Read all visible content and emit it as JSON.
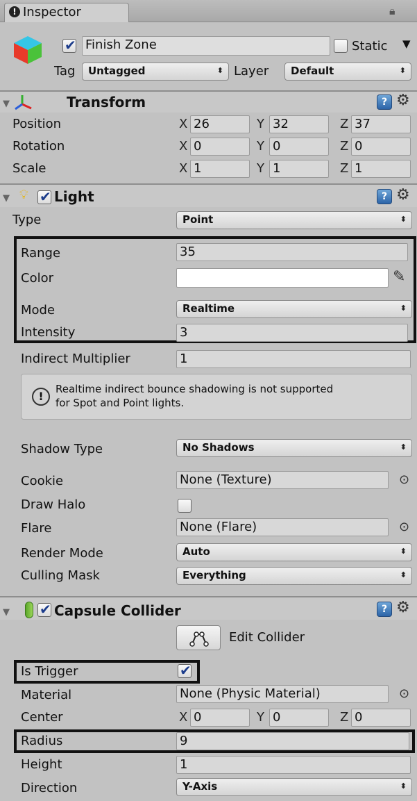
{
  "tab": {
    "title": "Inspector",
    "icon": "info-icon"
  },
  "object": {
    "enabled": true,
    "name": "Finish Zone",
    "static_label": "Static",
    "static_checked": false,
    "tag_label": "Tag",
    "tag_value": "Untagged",
    "layer_label": "Layer",
    "layer_value": "Default"
  },
  "transform": {
    "title": "Transform",
    "rows": [
      {
        "label": "Position",
        "x": "26",
        "y": "32",
        "z": "37"
      },
      {
        "label": "Rotation",
        "x": "0",
        "y": "0",
        "z": "0"
      },
      {
        "label": "Scale",
        "x": "1",
        "y": "1",
        "z": "1"
      }
    ]
  },
  "axes": {
    "x": "X",
    "y": "Y",
    "z": "Z"
  },
  "light": {
    "title": "Light",
    "enabled": true,
    "type_label": "Type",
    "type_value": "Point",
    "range_label": "Range",
    "range_value": "35",
    "color_label": "Color",
    "color_value": "#ffffff",
    "mode_label": "Mode",
    "mode_value": "Realtime",
    "intensity_label": "Intensity",
    "intensity_value": "3",
    "indirect_label": "Indirect Multiplier",
    "indirect_value": "1",
    "help_line1": "Realtime indirect bounce shadowing is not supported",
    "help_line2": "for Spot and Point lights.",
    "shadow_label": "Shadow Type",
    "shadow_value": "No Shadows",
    "cookie_label": "Cookie",
    "cookie_value": "None (Texture)",
    "halo_label": "Draw Halo",
    "halo_checked": false,
    "flare_label": "Flare",
    "flare_value": "None (Flare)",
    "render_label": "Render Mode",
    "render_value": "Auto",
    "culling_label": "Culling Mask",
    "culling_value": "Everything"
  },
  "collider": {
    "title": "Capsule Collider",
    "enabled": true,
    "edit_label": "Edit Collider",
    "trigger_label": "Is Trigger",
    "trigger_checked": true,
    "material_label": "Material",
    "material_value": "None (Physic Material)",
    "center_label": "Center",
    "center_x": "0",
    "center_y": "0",
    "center_z": "0",
    "radius_label": "Radius",
    "radius_value": "9",
    "height_label": "Height",
    "height_value": "1",
    "direction_label": "Direction",
    "direction_value": "Y-Axis"
  }
}
